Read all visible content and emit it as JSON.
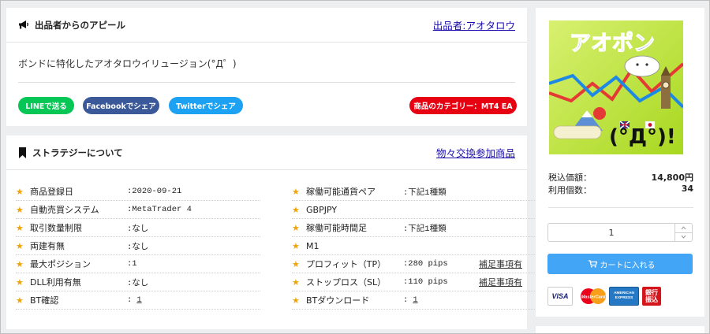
{
  "appeal": {
    "title": "出品者からのアピール",
    "seller_link": "出品者:アオタロウ",
    "text": "ボンドに特化したアオタロウイリュージョン(°Д゜)",
    "buttons": {
      "line": "LINEで送る",
      "facebook": "Facebookでシェア",
      "twitter": "Twitterでシェア",
      "category": "商品のカテゴリー：MT4 EA"
    }
  },
  "strategy": {
    "title": "ストラテジーについて",
    "barter_link": "物々交換参加商品",
    "left_rows": [
      {
        "label": "商品登録日",
        "value": ":2020-09-21"
      },
      {
        "label": "自動売買システム",
        "value": ":MetaTrader 4"
      },
      {
        "label": "取引数量制限",
        "value": ":なし"
      },
      {
        "label": "両建有無",
        "value": ":なし"
      },
      {
        "label": "最大ポジション",
        "value": ":1"
      },
      {
        "label": "DLL利用有無",
        "value": ":なし"
      },
      {
        "label": "BT確認",
        "value": ":",
        "link": "1"
      }
    ],
    "right_rows": [
      {
        "label": "稼働可能通貨ペア",
        "value": ":下記1種類"
      },
      {
        "label": "GBPJPY"
      },
      {
        "label": "稼働可能時間足",
        "value": ":下記1種類"
      },
      {
        "label": "M1"
      },
      {
        "label": "プロフィット（TP）",
        "value": ":280 pips",
        "note": "補足事項有"
      },
      {
        "label": "ストップロス（SL）",
        "value": ":110 pips",
        "note": "補足事項有"
      },
      {
        "label": "BTダウンロード",
        "value": ":",
        "link": "1"
      }
    ]
  },
  "product": {
    "image_text": {
      "title": "アオポン",
      "face": "(°Д°)!"
    },
    "price_label": "税込価額：",
    "price_value": "14,800円",
    "usage_label": "利用個数：",
    "usage_value": "34",
    "quantity": "1",
    "cart_label": "カートに入れる",
    "payments": {
      "visa": "VISA",
      "mastercard": "MasterCard",
      "amex_line1": "AMERICAN",
      "amex_line2": "EXPRESS",
      "bank_line1": "銀行",
      "bank_line2": "振込"
    }
  },
  "colors": {
    "line": "#06c755",
    "facebook": "#3b5998",
    "twitter": "#1da1f2",
    "category": "#e60012",
    "star": "#f0a30a",
    "cart": "#42a5f5",
    "link": "#1a0dab"
  },
  "icons": {
    "appeal_header": "megaphone-icon",
    "strategy_header": "bookmark-icon",
    "row_marker": "star-icon",
    "cart": "cart-icon",
    "stepper_up": "chevron-up-icon",
    "stepper_down": "chevron-down-icon"
  }
}
